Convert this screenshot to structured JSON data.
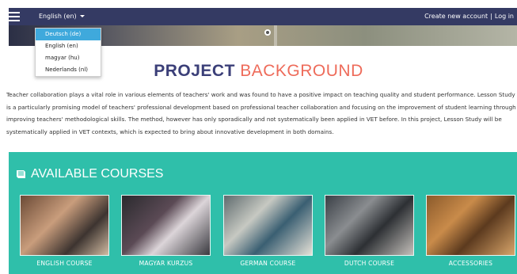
{
  "navbar": {
    "language_current": "English (en)",
    "create_account": "Create new account",
    "separator": "|",
    "login": "Log in"
  },
  "language_menu": {
    "options": [
      "Deutsch (de)",
      "English (en)",
      "magyar (hu)",
      "Nederlands (nl)"
    ],
    "highlighted": "Deutsch (de)"
  },
  "project": {
    "title_part1": "PROJECT",
    "title_part2": "BACKGROUND",
    "text": "Teacher collaboration plays a vital role in various elements of teachers' work and was found to have a positive impact on teaching quality and student performance. Lesson Study is a particularly promising model of teachers' professional development based on professional teacher collaboration and focusing on the improvement of student learning through improving teachers' methodological skills. The method, however has only sporadically and not systematically been applied in VET before. In this project, Lesson Study will be systematically applied in VET contexts, which is expected to bring about innovative development in both domains."
  },
  "courses": {
    "heading": "AVAILABLE COURSES",
    "items": [
      {
        "label": "ENGLISH COURSE"
      },
      {
        "label": "MAGYAR KURZUS"
      },
      {
        "label": "GERMAN COURSE"
      },
      {
        "label": "DUTCH COURSE"
      },
      {
        "label": "ACCESSORIES"
      }
    ]
  },
  "colors": {
    "navbar": "#343a63",
    "title_dark": "#3b3f78",
    "title_accent": "#ee6b5a",
    "courses_bg": "#2fbfaa",
    "menu_highlight": "#3fa9dc"
  }
}
